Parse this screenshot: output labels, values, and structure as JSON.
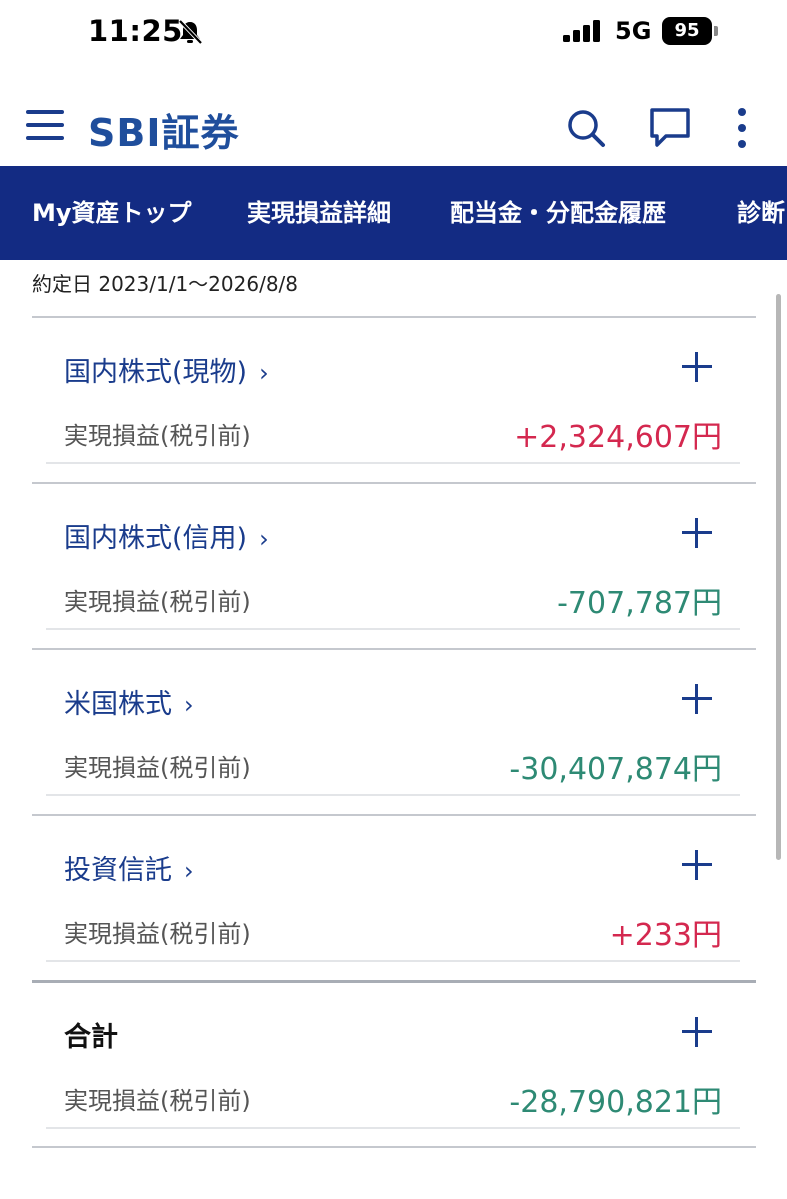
{
  "status_bar": {
    "time": "11:25",
    "network": "5G",
    "battery": "95"
  },
  "header": {
    "logo": "SBI証券"
  },
  "tabs": [
    {
      "label": "My資産トップ"
    },
    {
      "label": "実現損益詳細"
    },
    {
      "label": "配当金・分配金履歴"
    },
    {
      "label": "診断"
    }
  ],
  "date_range": "約定日 2023/1/1〜2026/8/8",
  "sections": [
    {
      "title": "国内株式(現物)",
      "label": "実現損益(税引前)",
      "value": "+2,324,607円",
      "sign": "positive"
    },
    {
      "title": "国内株式(信用)",
      "label": "実現損益(税引前)",
      "value": "-707,787円",
      "sign": "negative"
    },
    {
      "title": "米国株式",
      "label": "実現損益(税引前)",
      "value": "-30,407,874円",
      "sign": "negative"
    },
    {
      "title": "投資信託",
      "label": "実現損益(税引前)",
      "value": "+233円",
      "sign": "positive"
    }
  ],
  "total": {
    "title": "合計",
    "label": "実現損益(税引前)",
    "value": "-28,790,821円",
    "sign": "negative"
  },
  "colors": {
    "brand": "#1f4e9c",
    "nav_bg": "#132b83",
    "positive": "#d4284f",
    "negative": "#2e8a74"
  }
}
